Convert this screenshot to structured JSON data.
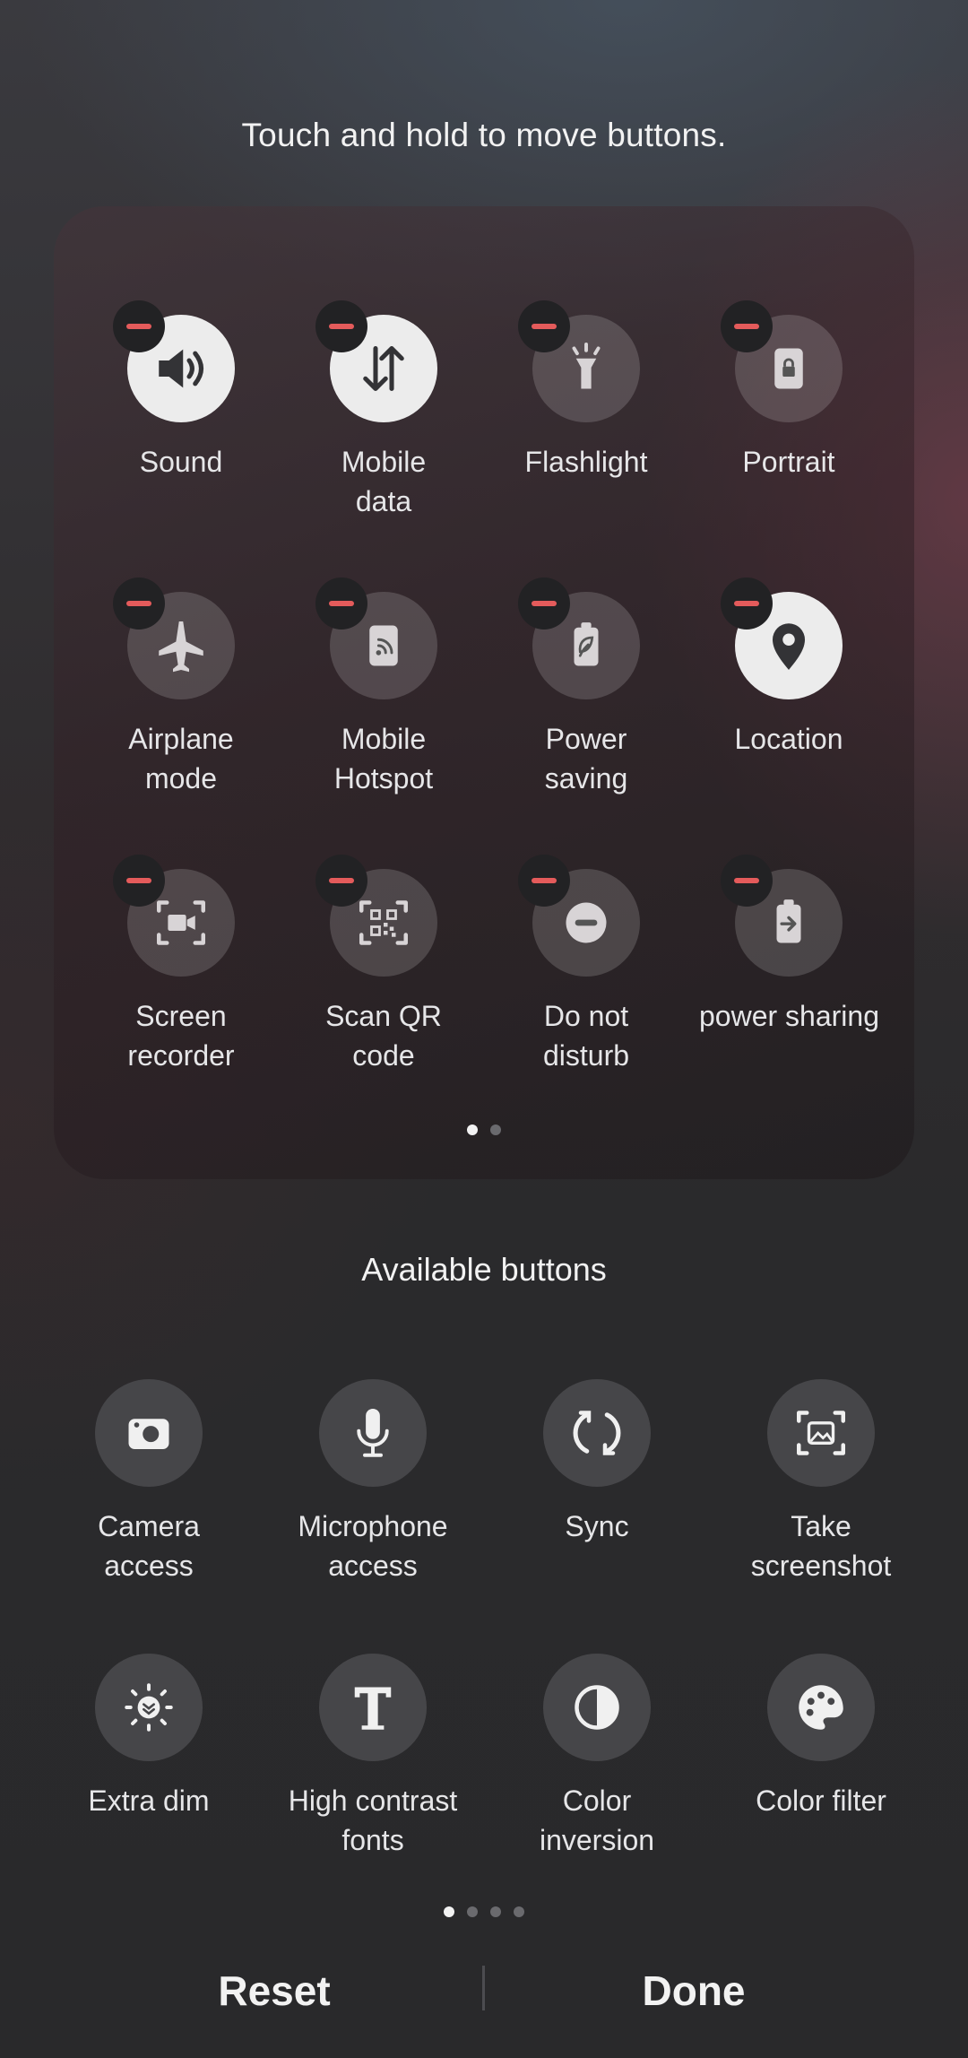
{
  "hint": "Touch and hold to move buttons.",
  "active_buttons": [
    {
      "label": "Sound",
      "icon": "sound-icon",
      "state": "on"
    },
    {
      "label": "Mobile\ndata",
      "icon": "mobile-data-icon",
      "state": "on"
    },
    {
      "label": "Flashlight",
      "icon": "flashlight-icon",
      "state": "off"
    },
    {
      "label": "Portrait",
      "icon": "portrait-lock-icon",
      "state": "off"
    },
    {
      "label": "Airplane\nmode",
      "icon": "airplane-icon",
      "state": "off"
    },
    {
      "label": "Mobile\nHotspot",
      "icon": "hotspot-icon",
      "state": "off"
    },
    {
      "label": "Power\nsaving",
      "icon": "power-saving-icon",
      "state": "off"
    },
    {
      "label": "Location",
      "icon": "location-icon",
      "state": "on"
    },
    {
      "label": "Screen\nrecorder",
      "icon": "screen-recorder-icon",
      "state": "off"
    },
    {
      "label": "Scan QR\ncode",
      "icon": "qr-code-icon",
      "state": "off"
    },
    {
      "label": "Do not\ndisturb",
      "icon": "do-not-disturb-icon",
      "state": "off"
    },
    {
      "label": "power sharing",
      "icon": "power-sharing-icon",
      "state": "off"
    }
  ],
  "active_pages": {
    "count": 2,
    "current": 1
  },
  "available_title": "Available buttons",
  "available_buttons": [
    {
      "label": "Camera\naccess",
      "icon": "camera-icon"
    },
    {
      "label": "Microphone\naccess",
      "icon": "microphone-icon"
    },
    {
      "label": "Sync",
      "icon": "sync-icon"
    },
    {
      "label": "Take\nscreenshot",
      "icon": "screenshot-icon"
    },
    {
      "label": "Extra dim",
      "icon": "extra-dim-icon"
    },
    {
      "label": "High contrast\nfonts",
      "icon": "high-contrast-fonts-icon"
    },
    {
      "label": "Color\ninversion",
      "icon": "color-inversion-icon"
    },
    {
      "label": "Color filter",
      "icon": "color-filter-icon"
    }
  ],
  "available_pages": {
    "count": 4,
    "current": 1
  },
  "reset_label": "Reset",
  "done_label": "Done",
  "colors": {
    "remove_badge": "#e45b5b",
    "tile_on": "#ececec",
    "tile_available": "#464649"
  }
}
